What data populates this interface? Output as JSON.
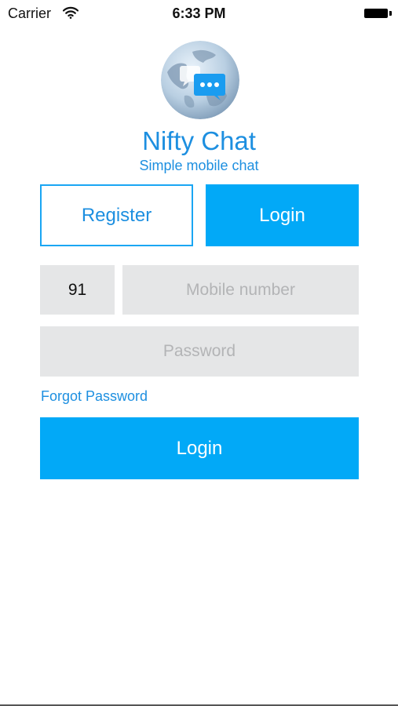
{
  "status_bar": {
    "carrier": "Carrier",
    "time": "6:33 PM",
    "wifi_icon": "wifi-icon",
    "battery_icon": "battery-icon"
  },
  "app": {
    "title": "Nifty Chat",
    "subtitle": "Simple mobile chat",
    "logo_icon": "globe-chat-bubble-icon"
  },
  "tabs": {
    "register_label": "Register",
    "login_label": "Login",
    "active": "login"
  },
  "form": {
    "country_code_value": "91",
    "mobile_placeholder": "Mobile number",
    "password_placeholder": "Password",
    "forgot_password_label": "Forgot Password",
    "submit_label": "Login"
  },
  "colors": {
    "accent": "#02a9f7",
    "text_accent": "#1d8fe0",
    "field_bg": "#e5e6e7",
    "placeholder": "#b3b4b6"
  }
}
